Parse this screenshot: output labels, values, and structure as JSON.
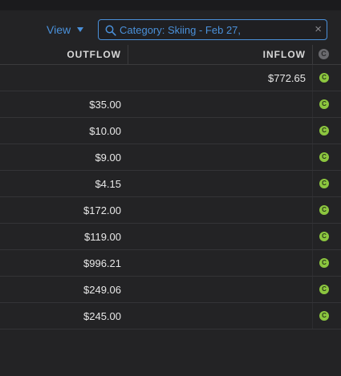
{
  "toolbar": {
    "view_label": "View",
    "search_value": "Category: Skiing - Feb 27,",
    "clear_label": "×"
  },
  "table": {
    "headers": {
      "outflow": "OUTFLOW",
      "inflow": "INFLOW",
      "cleared": "C"
    },
    "rows": [
      {
        "outflow": "",
        "inflow": "$772.65",
        "cleared": "C"
      },
      {
        "outflow": "$35.00",
        "inflow": "",
        "cleared": "C"
      },
      {
        "outflow": "$10.00",
        "inflow": "",
        "cleared": "C"
      },
      {
        "outflow": "$9.00",
        "inflow": "",
        "cleared": "C"
      },
      {
        "outflow": "$4.15",
        "inflow": "",
        "cleared": "C"
      },
      {
        "outflow": "$172.00",
        "inflow": "",
        "cleared": "C"
      },
      {
        "outflow": "$119.00",
        "inflow": "",
        "cleared": "C"
      },
      {
        "outflow": "$996.21",
        "inflow": "",
        "cleared": "C"
      },
      {
        "outflow": "$249.06",
        "inflow": "",
        "cleared": "C"
      },
      {
        "outflow": "$245.00",
        "inflow": "",
        "cleared": "C"
      }
    ]
  },
  "colors": {
    "accent": "#4a90d9",
    "cleared": "#8cc63f",
    "background": "#232325"
  },
  "icons": {
    "search": "search-icon",
    "clear": "close-icon",
    "view_caret": "chevron-down-icon",
    "cleared": "cleared-icon"
  }
}
